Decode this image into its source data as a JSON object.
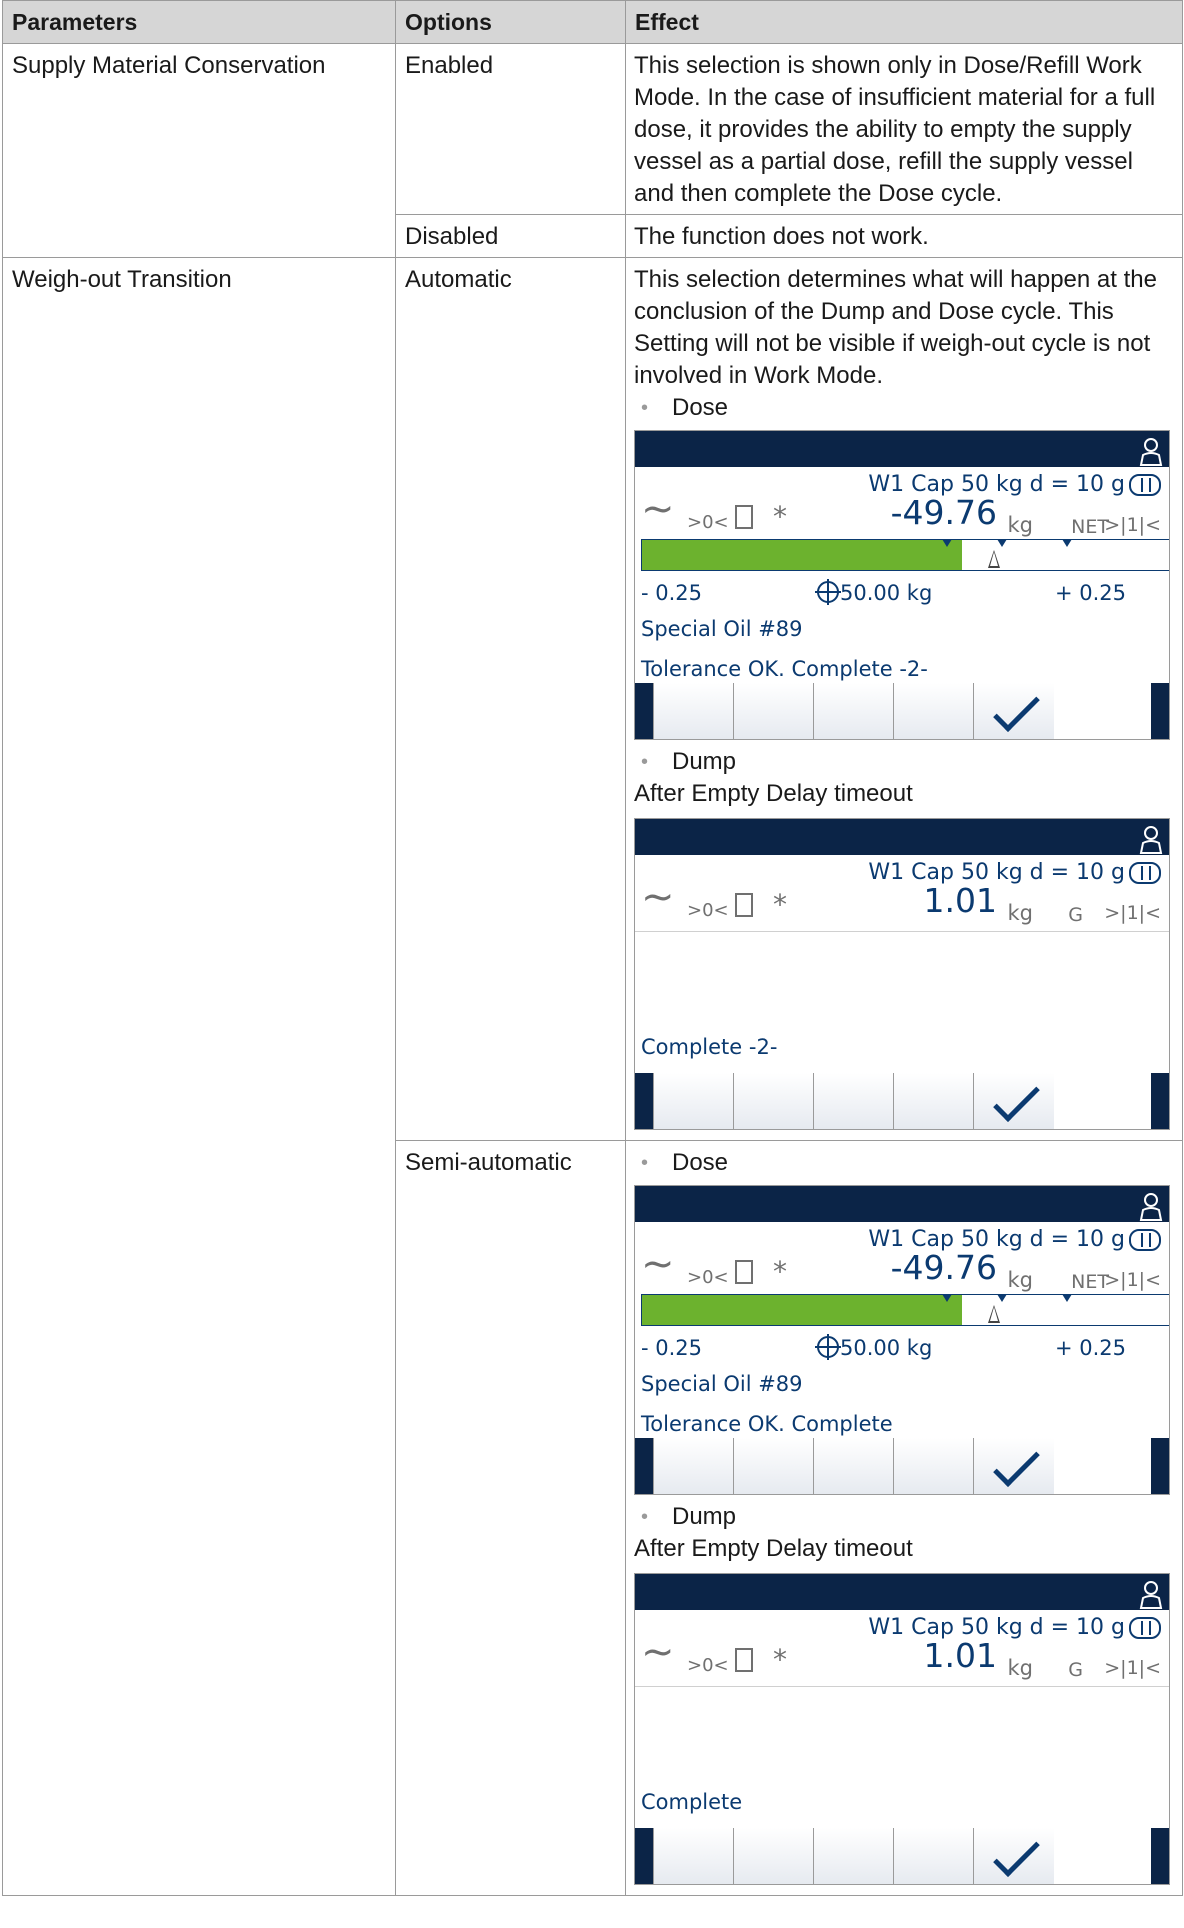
{
  "table": {
    "headers": [
      "Parameters",
      "Options",
      "Effect"
    ],
    "smc": {
      "parameter": "Supply Material Conservation",
      "enabled_option": "Enabled",
      "enabled_effect": "This selection is shown only in Dose/Refill Work Mode. In the case of insufficient material for a full dose, it provides the ability to empty the supply vessel as a partial dose, refill the supply vessel and then complete the Dose cycle.",
      "disabled_option": "Disabled",
      "disabled_effect": "The function does not work."
    },
    "wot": {
      "parameter": "Weigh-out Transition",
      "automatic_option": "Automatic",
      "automatic_intro": "This selection determines what will happen at the conclusion of the Dump and Dose cycle. This Setting will not be visible if weigh-out cycle is not involved in Work Mode.",
      "semi_option": "Semi-automatic",
      "bullet_dose": "Dose",
      "bullet_dump": "Dump",
      "after_delay": "After Empty Delay timeout"
    }
  },
  "screen_common": {
    "cap_line": "W1 Cap 50 kg d = 10 g",
    "zero_symbol": ">0<",
    "star_symbol": "*",
    "range_symbol": ">|1|<",
    "unit": "kg",
    "tol_minus": "- 0.25",
    "target": "50.00 kg",
    "tol_plus": "+ 0.25",
    "material": "Special Oil #89",
    "colors": {
      "header": "#0b2447",
      "text": "#0b3a70",
      "fill": "#6cb22e"
    },
    "icons": [
      "user-icon",
      "motion-icon",
      "zero-icon",
      "tare-icon",
      "star-icon",
      "range-icon",
      "target-icon",
      "checkmark-icon"
    ]
  },
  "screens": {
    "auto_dose": {
      "weight": "-49.76",
      "mode": "NET",
      "status": "Tolerance OK. Complete -2-",
      "fill_fraction": 0.607
    },
    "auto_dump": {
      "weight": "1.01",
      "mode": "G",
      "status": "Complete -2-"
    },
    "semi_dose": {
      "weight": "-49.76",
      "mode": "NET",
      "status": "Tolerance OK. Complete",
      "fill_fraction": 0.607
    },
    "semi_dump": {
      "weight": "1.01",
      "mode": "G",
      "status": "Complete"
    }
  }
}
